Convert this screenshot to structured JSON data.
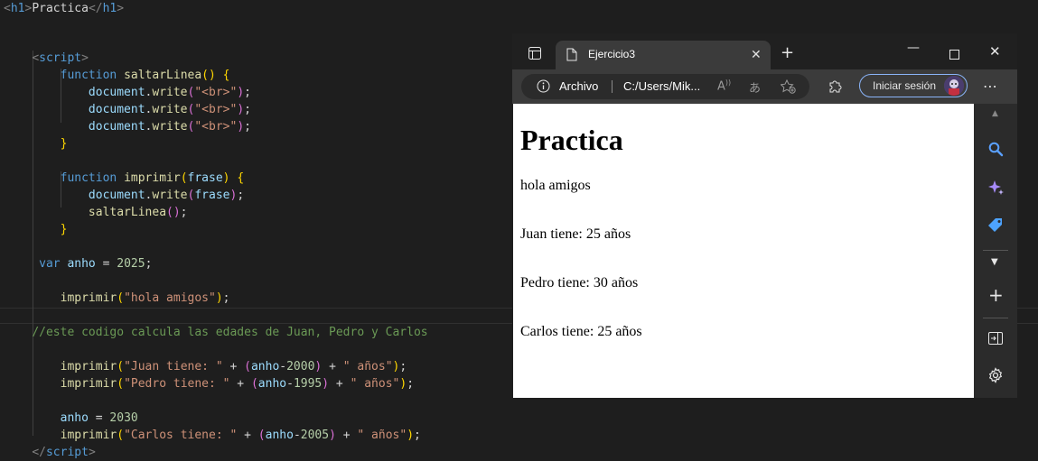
{
  "editor": {
    "lines": [
      [
        [
          "t-br",
          "<"
        ],
        [
          "t-tag",
          "h1"
        ],
        [
          "t-br",
          ">"
        ],
        [
          "t-txt",
          "Practica"
        ],
        [
          "t-br",
          "</"
        ],
        [
          "t-tag",
          "h1"
        ],
        [
          "t-br",
          ">"
        ]
      ],
      [],
      [
        [
          "t-txt",
          "    "
        ],
        [
          "t-br",
          "<"
        ],
        [
          "t-tag",
          "script"
        ],
        [
          "t-br",
          ">"
        ]
      ],
      [
        [
          "t-txt",
          "        "
        ],
        [
          "t-kw",
          "function"
        ],
        [
          "t-txt",
          " "
        ],
        [
          "t-fn",
          "saltarLinea"
        ],
        [
          "t-p1",
          "()"
        ],
        [
          "t-txt",
          " "
        ],
        [
          "t-p1",
          "{"
        ]
      ],
      [
        [
          "t-txt",
          "            "
        ],
        [
          "t-var",
          "document"
        ],
        [
          "t-txt",
          "."
        ],
        [
          "t-fn",
          "write"
        ],
        [
          "t-p2",
          "("
        ],
        [
          "t-str",
          "\"<br>\""
        ],
        [
          "t-p2",
          ")"
        ],
        [
          "t-txt",
          ";"
        ]
      ],
      [
        [
          "t-txt",
          "            "
        ],
        [
          "t-var",
          "document"
        ],
        [
          "t-txt",
          "."
        ],
        [
          "t-fn",
          "write"
        ],
        [
          "t-p2",
          "("
        ],
        [
          "t-str",
          "\"<br>\""
        ],
        [
          "t-p2",
          ")"
        ],
        [
          "t-txt",
          ";"
        ]
      ],
      [
        [
          "t-txt",
          "            "
        ],
        [
          "t-var",
          "document"
        ],
        [
          "t-txt",
          "."
        ],
        [
          "t-fn",
          "write"
        ],
        [
          "t-p2",
          "("
        ],
        [
          "t-str",
          "\"<br>\""
        ],
        [
          "t-p2",
          ")"
        ],
        [
          "t-txt",
          ";"
        ]
      ],
      [
        [
          "t-txt",
          "        "
        ],
        [
          "t-p1",
          "}"
        ]
      ],
      [],
      [
        [
          "t-txt",
          "        "
        ],
        [
          "t-kw",
          "function"
        ],
        [
          "t-txt",
          " "
        ],
        [
          "t-fn",
          "imprimir"
        ],
        [
          "t-p1",
          "("
        ],
        [
          "t-var",
          "frase"
        ],
        [
          "t-p1",
          ")"
        ],
        [
          "t-txt",
          " "
        ],
        [
          "t-p1",
          "{"
        ]
      ],
      [
        [
          "t-txt",
          "            "
        ],
        [
          "t-var",
          "document"
        ],
        [
          "t-txt",
          "."
        ],
        [
          "t-fn",
          "write"
        ],
        [
          "t-p2",
          "("
        ],
        [
          "t-var",
          "frase"
        ],
        [
          "t-p2",
          ")"
        ],
        [
          "t-txt",
          ";"
        ]
      ],
      [
        [
          "t-txt",
          "            "
        ],
        [
          "t-fn",
          "saltarLinea"
        ],
        [
          "t-p2",
          "()"
        ],
        [
          "t-txt",
          ";"
        ]
      ],
      [
        [
          "t-txt",
          "        "
        ],
        [
          "t-p1",
          "}"
        ]
      ],
      [],
      [
        [
          "t-txt",
          "     "
        ],
        [
          "t-kw",
          "var"
        ],
        [
          "t-txt",
          " "
        ],
        [
          "t-var",
          "anho"
        ],
        [
          "t-txt",
          " = "
        ],
        [
          "t-num",
          "2025"
        ],
        [
          "t-txt",
          ";"
        ]
      ],
      [],
      [
        [
          "t-txt",
          "        "
        ],
        [
          "t-fn",
          "imprimir"
        ],
        [
          "t-p1",
          "("
        ],
        [
          "t-str",
          "\"hola amigos\""
        ],
        [
          "t-p1",
          ")"
        ],
        [
          "t-txt",
          ";"
        ]
      ],
      [],
      [
        [
          "t-txt",
          "    "
        ],
        [
          "t-com",
          "//este codigo calcula las edades de Juan, Pedro y Carlos"
        ]
      ],
      [],
      [
        [
          "t-txt",
          "        "
        ],
        [
          "t-fn",
          "imprimir"
        ],
        [
          "t-p1",
          "("
        ],
        [
          "t-str",
          "\"Juan tiene: \""
        ],
        [
          "t-txt",
          " + "
        ],
        [
          "t-p2",
          "("
        ],
        [
          "t-var",
          "anho"
        ],
        [
          "t-txt",
          "-"
        ],
        [
          "t-num",
          "2000"
        ],
        [
          "t-p2",
          ")"
        ],
        [
          "t-txt",
          " + "
        ],
        [
          "t-str",
          "\" años\""
        ],
        [
          "t-p1",
          ")"
        ],
        [
          "t-txt",
          ";"
        ]
      ],
      [
        [
          "t-txt",
          "        "
        ],
        [
          "t-fn",
          "imprimir"
        ],
        [
          "t-p1",
          "("
        ],
        [
          "t-str",
          "\"Pedro tiene: \""
        ],
        [
          "t-txt",
          " + "
        ],
        [
          "t-p2",
          "("
        ],
        [
          "t-var",
          "anho"
        ],
        [
          "t-txt",
          "-"
        ],
        [
          "t-num",
          "1995"
        ],
        [
          "t-p2",
          ")"
        ],
        [
          "t-txt",
          " + "
        ],
        [
          "t-str",
          "\" años\""
        ],
        [
          "t-p1",
          ")"
        ],
        [
          "t-txt",
          ";"
        ]
      ],
      [],
      [
        [
          "t-txt",
          "        "
        ],
        [
          "t-var",
          "anho"
        ],
        [
          "t-txt",
          " = "
        ],
        [
          "t-num",
          "2030"
        ]
      ],
      [
        [
          "t-txt",
          "        "
        ],
        [
          "t-fn",
          "imprimir"
        ],
        [
          "t-p1",
          "("
        ],
        [
          "t-str",
          "\"Carlos tiene: \""
        ],
        [
          "t-txt",
          " + "
        ],
        [
          "t-p2",
          "("
        ],
        [
          "t-var",
          "anho"
        ],
        [
          "t-txt",
          "-"
        ],
        [
          "t-num",
          "2005"
        ],
        [
          "t-p2",
          ")"
        ],
        [
          "t-txt",
          " + "
        ],
        [
          "t-str",
          "\" años\""
        ],
        [
          "t-p1",
          ")"
        ],
        [
          "t-txt",
          ";"
        ]
      ],
      [
        [
          "t-txt",
          "    "
        ],
        [
          "t-br",
          "</"
        ],
        [
          "t-tag",
          "script"
        ],
        [
          "t-br",
          ">"
        ]
      ]
    ]
  },
  "browser": {
    "tab_title": "Ejercicio3",
    "address_label": "Archivo",
    "address_url": "C:/Users/Mik...",
    "signin_label": "Iniciar sesión",
    "icons": [
      "sidebar-toggle-icon",
      "page-icon",
      "close-icon",
      "plus-icon",
      "minimize-icon",
      "maximize-icon",
      "window-close-icon",
      "info-icon",
      "read-aloud-icon",
      "translate-icon",
      "favorite-add-icon",
      "extensions-icon",
      "more-icon",
      "search-icon",
      "copilot-icon",
      "shopping-tag-icon",
      "chevron-down-icon",
      "add-icon",
      "split-screen-icon",
      "settings-icon"
    ]
  },
  "page": {
    "heading": "Practica",
    "lines": [
      "hola amigos",
      "Juan tiene: 25 años",
      "Pedro tiene: 30 años",
      "Carlos tiene: 25 años"
    ]
  }
}
